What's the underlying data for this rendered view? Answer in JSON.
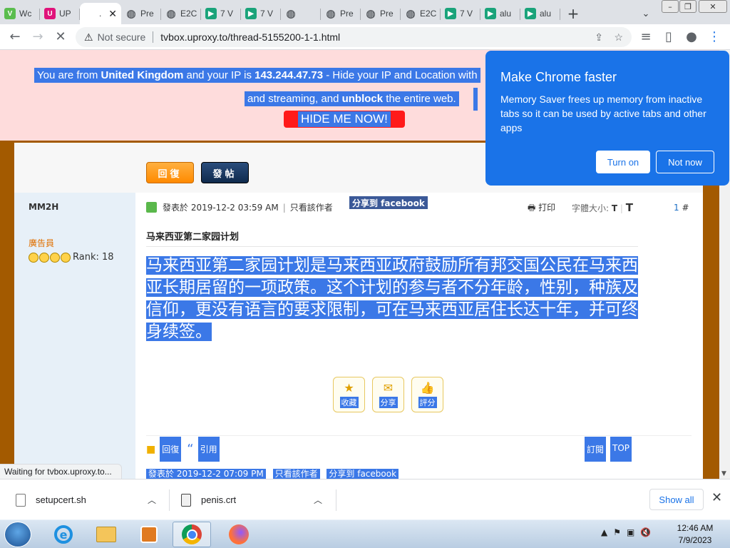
{
  "browser": {
    "tabs": [
      {
        "label": "Wc",
        "favicon_color": "#5bbd4e",
        "favicon_char": "V"
      },
      {
        "label": "UP",
        "favicon_color": "#e0137a",
        "favicon_char": "U"
      },
      {
        "label": ".",
        "favicon_color": "#ffffff",
        "favicon_char": "",
        "active": true
      },
      {
        "label": "Pre",
        "favicon_color": "#5f6368",
        "favicon_char": "◍"
      },
      {
        "label": "E2C",
        "favicon_color": "#5f6368",
        "favicon_char": "◍"
      },
      {
        "label": "7 V",
        "favicon_color": "#1aa37a",
        "favicon_char": "▶"
      },
      {
        "label": "7 V",
        "favicon_color": "#1aa37a",
        "favicon_char": "▶"
      },
      {
        "label": "",
        "favicon_color": "#5f6368",
        "favicon_char": "◍"
      },
      {
        "label": "Pre",
        "favicon_color": "#5f6368",
        "favicon_char": "◍"
      },
      {
        "label": "Pre",
        "favicon_color": "#5f6368",
        "favicon_char": "◍"
      },
      {
        "label": "E2C",
        "favicon_color": "#5f6368",
        "favicon_char": "◍"
      },
      {
        "label": "7 V",
        "favicon_color": "#1aa37a",
        "favicon_char": "▶"
      },
      {
        "label": "alu",
        "favicon_color": "#1aa37a",
        "favicon_char": "▶"
      },
      {
        "label": "alu",
        "favicon_color": "#1aa37a",
        "favicon_char": "▶"
      }
    ],
    "new_tab": "+",
    "security_label": "Not secure",
    "url": "tvbox.uproxy.to/thread-5155200-1-1.html",
    "status_text": "Waiting for tvbox.uproxy.to..."
  },
  "promo": {
    "line1_pre": "You are from ",
    "country": "United Kingdom",
    "line1_mid": " and your IP is ",
    "ip": "143.244.47.73",
    "line1_post": " - Hide your IP and Location with",
    "line2_pre": "and streaming, and ",
    "unblock": "unblock",
    "line2_post": " the entire web.",
    "button": "HIDE ME NOW!"
  },
  "forum": {
    "reply_button": "回復",
    "post_button": "發帖",
    "author": "MM2H",
    "role": "廣告員",
    "rank": "Rank: 18",
    "posted": "發表於 2019-12-2 03:59 AM",
    "only_author": "只看該作者",
    "fb_share": "分享到 facebook",
    "print": "打印",
    "font_size": "字體大小:",
    "floor_num": "1",
    "floor_sign": "#",
    "title": "马来西亚第二家园计划",
    "body": "马来西亚第二家园计划是马来西亚政府鼓励所有邦交国公民在马来西亚长期居留的一项政策。这个计划的参与者不分年龄，性别，种族及信仰，更没有语言的要求限制，可在马来西亚居住长达十年，并可终身续签。",
    "actions": [
      {
        "label": "收藏",
        "icon": "star-icon"
      },
      {
        "label": "分享",
        "icon": "mail-icon"
      },
      {
        "label": "評分",
        "icon": "thumb-icon"
      }
    ],
    "reply_link": "回復",
    "quote_link": "引用",
    "subscribe": "訂閱",
    "top": "TOP",
    "next_posted": "發表於 2019-12-2 07:09 PM",
    "next_only_author": "只看該作者",
    "next_fb_share": "分享到 facebook"
  },
  "popup": {
    "title": "Make Chrome faster",
    "text": "Memory Saver frees up memory from inactive tabs so it can be used by active tabs and other apps",
    "turn_on": "Turn on",
    "not_now": "Not now"
  },
  "downloads": {
    "items": [
      "setupcert.sh",
      "penis.crt"
    ],
    "show_all": "Show all"
  },
  "taskbar": {
    "time": "12:46 AM",
    "date": "7/9/2023"
  }
}
